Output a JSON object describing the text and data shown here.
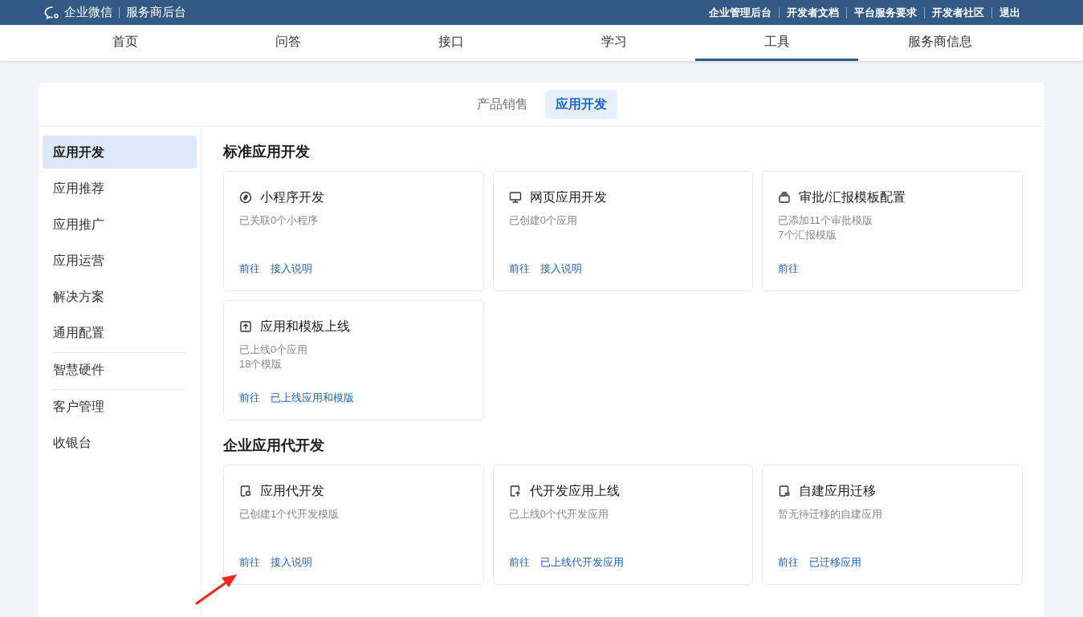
{
  "header": {
    "logo_text": "企业微信",
    "subtitle": "服务商后台",
    "links": [
      "企业管理后台",
      "开发者文档",
      "平台服务要求",
      "开发者社区",
      "退出"
    ]
  },
  "nav": [
    {
      "label": "首页",
      "selected": false
    },
    {
      "label": "问答",
      "selected": false
    },
    {
      "label": "接口",
      "selected": false
    },
    {
      "label": "学习",
      "selected": false
    },
    {
      "label": "工具",
      "selected": true
    },
    {
      "label": "服务商信息",
      "selected": false
    }
  ],
  "subtabs": [
    {
      "label": "产品销售",
      "selected": false
    },
    {
      "label": "应用开发",
      "selected": true
    }
  ],
  "sidebar": {
    "groups": [
      [
        {
          "label": "应用开发",
          "selected": true
        },
        {
          "label": "应用推荐",
          "selected": false
        },
        {
          "label": "应用推广",
          "selected": false
        },
        {
          "label": "应用运营",
          "selected": false
        },
        {
          "label": "解决方案",
          "selected": false
        },
        {
          "label": "通用配置",
          "selected": false
        }
      ],
      [
        {
          "label": "智慧硬件",
          "selected": false
        }
      ],
      [
        {
          "label": "客户管理",
          "selected": false
        },
        {
          "label": "收银台",
          "selected": false
        }
      ]
    ]
  },
  "sections": [
    {
      "title": "标准应用开发",
      "cards": [
        {
          "kind": "link",
          "title": "小程序开发",
          "lines": [
            "已关联0个小程序"
          ],
          "links": [
            "前往",
            "接入说明"
          ]
        },
        {
          "kind": "monitor",
          "title": "网页应用开发",
          "lines": [
            "已创建0个应用"
          ],
          "links": [
            "前往",
            "接入说明"
          ]
        },
        {
          "kind": "tray",
          "title": "审批/汇报模板配置",
          "lines": [
            "已添加11个审批模版",
            "7个汇报模版"
          ],
          "links": [
            "前往"
          ]
        },
        {
          "kind": "upload",
          "title": "应用和模板上线",
          "lines": [
            "已上线0个应用",
            "18个模版"
          ],
          "links": [
            "前往",
            "已上线应用和模版"
          ]
        }
      ]
    },
    {
      "title": "企业应用代开发",
      "cards": [
        {
          "kind": "docgear",
          "title": "应用代开发",
          "lines": [
            "已创建1个代开发模版"
          ],
          "links": [
            "前往",
            "接入说明"
          ]
        },
        {
          "kind": "docup",
          "title": "代开发应用上线",
          "lines": [
            "已上线0个代开发应用"
          ],
          "links": [
            "前往",
            "已上线代开发应用"
          ]
        },
        {
          "kind": "docmove",
          "title": "自建应用迁移",
          "lines": [
            "暂无待迁移的自建应用"
          ],
          "links": [
            "前往",
            "已迁移应用"
          ]
        }
      ]
    }
  ]
}
